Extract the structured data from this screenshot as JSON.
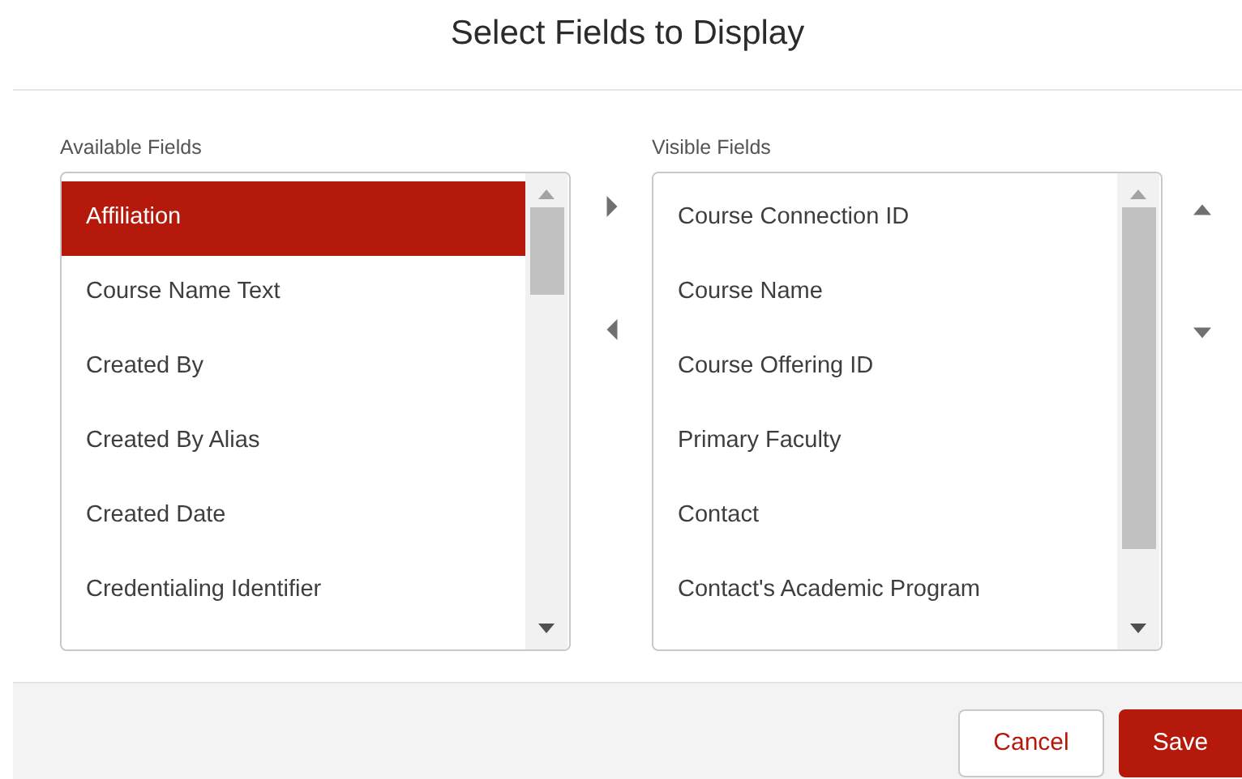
{
  "title": "Select Fields to Display",
  "available": {
    "label": "Available Fields",
    "items": [
      {
        "label": "Affiliation",
        "selected": true
      },
      {
        "label": "Course Name Text",
        "selected": false
      },
      {
        "label": "Created By",
        "selected": false
      },
      {
        "label": "Created By Alias",
        "selected": false
      },
      {
        "label": "Created Date",
        "selected": false
      },
      {
        "label": "Credentialing Identifier",
        "selected": false
      }
    ]
  },
  "visible": {
    "label": "Visible Fields",
    "items": [
      {
        "label": "Course Connection ID",
        "selected": false
      },
      {
        "label": "Course Name",
        "selected": false
      },
      {
        "label": "Course Offering ID",
        "selected": false
      },
      {
        "label": "Primary Faculty",
        "selected": false
      },
      {
        "label": "Contact",
        "selected": false
      },
      {
        "label": "Contact's Academic Program",
        "selected": false
      }
    ]
  },
  "buttons": [
    {
      "label": "Cancel",
      "kind": "neutral"
    },
    {
      "label": "Save",
      "kind": "brand"
    }
  ]
}
